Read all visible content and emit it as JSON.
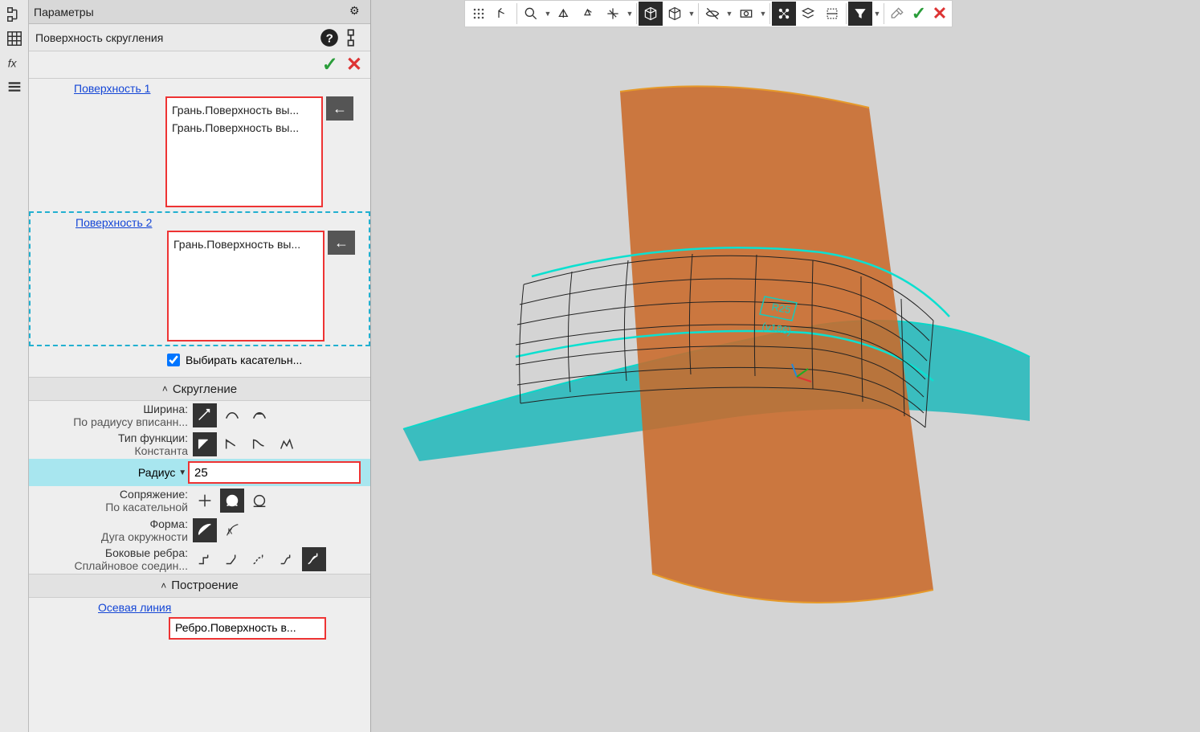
{
  "panel": {
    "title": "Параметры",
    "subtitle": "Поверхность скругления"
  },
  "surfaces": {
    "s1_label": "Поверхность 1",
    "s1_items": [
      "Грань.Поверхность вы...",
      "Грань.Поверхность вы..."
    ],
    "s2_label": "Поверхность 2",
    "s2_items": [
      "Грань.Поверхность вы..."
    ],
    "tangent_checkbox": "Выбирать касательн..."
  },
  "sections": {
    "fillet": "Скругление",
    "build": "Построение"
  },
  "fillet": {
    "width_l1": "Ширина:",
    "width_l2": "По радиусу вписанн...",
    "func_l1": "Тип функции:",
    "func_l2": "Константа",
    "radius_label": "Радиус",
    "radius_value": "25",
    "conj_l1": "Сопряжение:",
    "conj_l2": "По касательной",
    "form_l1": "Форма:",
    "form_l2": "Дуга окружности",
    "side_l1": "Боковые ребра:",
    "side_l2": "Сплайновое соедин..."
  },
  "build": {
    "axis_label": "Осевая линия",
    "axis_value": "Ребро.Поверхность в..."
  },
  "icons": {
    "gear": "⚙",
    "help": "?",
    "back_arrow": "←"
  }
}
